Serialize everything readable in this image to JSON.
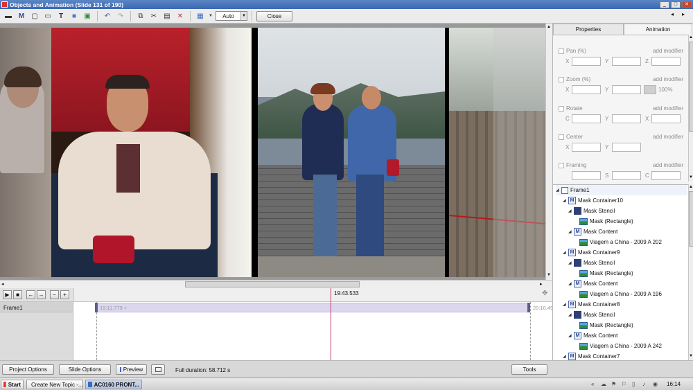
{
  "window": {
    "title": "Objects and Animation (Slide 131 of 190)"
  },
  "toolbar": {
    "zoom_value": "Auto",
    "close_label": "Close"
  },
  "timeline": {
    "marker_time": "19:43.533",
    "start_time": "19:11.779 +",
    "end_time": "20:10.49",
    "track_name": "Frame1"
  },
  "bottom": {
    "project_options": "Project Options",
    "slide_options": "Slide Options",
    "preview": "Preview",
    "full_duration": "Full duration: 58.712 s",
    "tools": "Tools"
  },
  "panel": {
    "tabs": [
      {
        "label": "Properties"
      },
      {
        "label": "Animation"
      }
    ],
    "add_modifier": "add modifier",
    "props": {
      "pan": {
        "label": "Pan (%)",
        "axes": [
          "X",
          "Y",
          "Z"
        ]
      },
      "zoom": {
        "label": "Zoom (%)",
        "axes": [
          "X",
          "Y"
        ],
        "extra": "100%"
      },
      "rotate": {
        "label": "Rotate",
        "axes": [
          "C",
          "Y",
          "X"
        ]
      },
      "center": {
        "label": "Center",
        "axes": [
          "X",
          "Y"
        ]
      },
      "framing": {
        "label": "Framing",
        "axes": [
          "",
          "S",
          "C"
        ]
      }
    },
    "tree": [
      {
        "label": "Frame1",
        "icon": "frame"
      },
      {
        "label": "Mask Container10",
        "icon": "m"
      },
      {
        "label": "Mask Stencil",
        "icon": "mask"
      },
      {
        "label": "Mask (Rectangle)",
        "icon": "img"
      },
      {
        "label": "Mask Content",
        "icon": "m"
      },
      {
        "label": "Viagem a China - 2009 A 202",
        "icon": "img"
      },
      {
        "label": "Mask Container9",
        "icon": "m"
      },
      {
        "label": "Mask Stencil",
        "icon": "mask"
      },
      {
        "label": "Mask (Rectangle)",
        "icon": "img"
      },
      {
        "label": "Mask Content",
        "icon": "m"
      },
      {
        "label": "Viagem a China - 2009 A 196",
        "icon": "img"
      },
      {
        "label": "Mask Container8",
        "icon": "m"
      },
      {
        "label": "Mask Stencil",
        "icon": "mask"
      },
      {
        "label": "Mask (Rectangle)",
        "icon": "img"
      },
      {
        "label": "Mask Content",
        "icon": "m"
      },
      {
        "label": "Viagem a China - 2009 A 242",
        "icon": "img"
      },
      {
        "label": "Mask Container7",
        "icon": "m"
      }
    ]
  },
  "taskbar": {
    "start": "Start",
    "tasks": [
      {
        "label": "Create New Topic -..."
      },
      {
        "label": "AC0160 PRONT..."
      }
    ],
    "clock": "16:14"
  }
}
